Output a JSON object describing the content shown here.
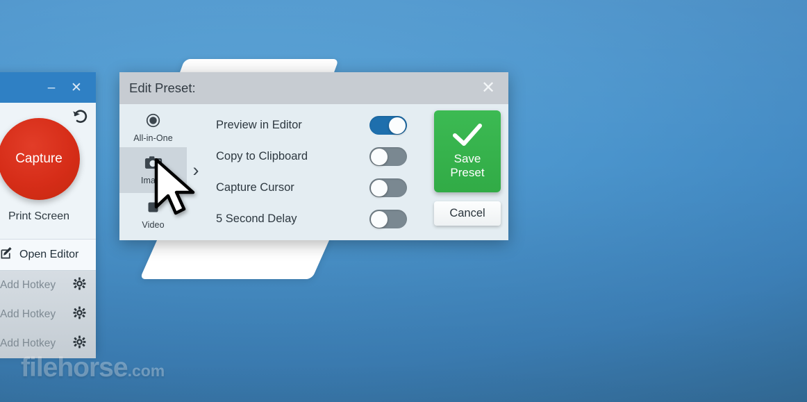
{
  "desktop": {
    "background_top_color": "#55a0d4",
    "background_bottom_color": "#35719f",
    "watermark_name": "filehorse",
    "watermark_tld": ".com"
  },
  "app_panel": {
    "titlebar": {
      "minimize_label": "–",
      "close_label": "✕"
    },
    "reset_icon": "undo-arrow-icon",
    "capture_button_label": "Capture",
    "capture_hotkey_label": "Print Screen",
    "open_editor_label": "Open Editor",
    "open_editor_icon": "edit-square-icon",
    "hotkey_rows": [
      {
        "label": "Add Hotkey",
        "icon": "gear-icon"
      },
      {
        "label": "Add Hotkey",
        "icon": "gear-icon"
      },
      {
        "label": "Add Hotkey",
        "icon": "gear-icon"
      }
    ]
  },
  "preset_dialog": {
    "title": "Edit Preset:",
    "close_label": "✕",
    "titlebar_color": "#c7ccd2",
    "body_color": "#e4edf2",
    "modes": [
      {
        "label": "All-in-One",
        "icon": "record-circle-icon",
        "selected": false
      },
      {
        "label": "Image",
        "icon": "camera-icon",
        "selected": true
      },
      {
        "label": "Video",
        "icon": "video-square-icon",
        "selected": false
      }
    ],
    "chevron": "›",
    "options": [
      {
        "label": "Preview in Editor",
        "state": "on"
      },
      {
        "label": "Copy to Clipboard",
        "state": "off"
      },
      {
        "label": "Capture Cursor",
        "state": "off"
      },
      {
        "label": "5 Second Delay",
        "state": "off"
      }
    ],
    "toggle_on_color": "#1e6fad",
    "toggle_off_color": "#7a8891",
    "save_button": {
      "label": "Save\nPreset",
      "icon": "checkmark-icon",
      "color": "#31ab46"
    },
    "cancel_button": {
      "label": "Cancel"
    }
  },
  "cursor": {
    "icon": "mouse-arrow-cursor"
  }
}
